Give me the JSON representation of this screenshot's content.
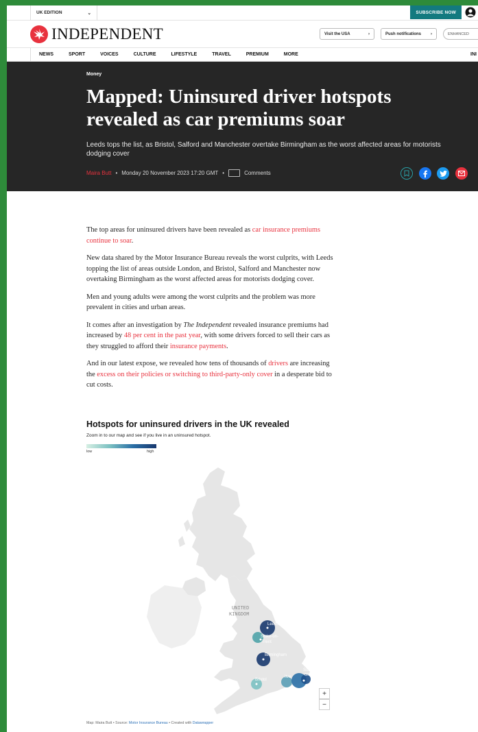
{
  "topbar": {
    "edition": "UK EDITION",
    "subscribe": "SUBSCRIBE NOW"
  },
  "brand": {
    "name": "INDEPENDENT"
  },
  "header_buttons": {
    "visit_usa": "Visit the USA",
    "push": "Push notifications",
    "enhanced": "ENHANCED"
  },
  "nav": {
    "items": [
      "NEWS",
      "SPORT",
      "VOICES",
      "CULTURE",
      "LIFESTYLE",
      "TRAVEL",
      "PREMIUM",
      "MORE"
    ],
    "right_edge": "INI"
  },
  "article": {
    "section": "Money",
    "headline": "Mapped: Uninsured driver hotspots revealed as car premiums soar",
    "standfirst": "Leeds tops the list, as Bristol, Salford and Manchester overtake Birmingham as the worst affected areas for motorists dodging cover",
    "author": "Maira Butt",
    "date": "Monday 20 November 2023 17:20 GMT",
    "separator": "•",
    "comments": "Comments",
    "p1_a": "The top areas for uninsured drivers have been revealed as ",
    "p1_link": "car insurance premiums continue to soar",
    "p1_b": ".",
    "p2": "New data shared by the Motor Insurance Bureau reveals the worst culprits, with Leeds topping the list of areas outside London, and Bristol, Salford and Manchester now overtaking Birmingham as the worst affected areas for motorists dodging cover.",
    "p3": "Men and young adults were among the worst culprits and the problem was more prevalent in cities and urban areas.",
    "p4_a": "It comes after an investigation by ",
    "p4_em": "The Independent",
    "p4_b": " revealed insurance premiums had increased by ",
    "p4_link1": "48 per cent in the past year",
    "p4_c": ", with some drivers forced to sell their cars as they struggled to afford their ",
    "p4_link2": "insurance payments",
    "p4_d": ".",
    "p5_a": "And in our latest expose, we revealed how tens of thousands of ",
    "p5_link1": "drivers",
    "p5_b": " are increasing the ",
    "p5_link2": "excess on their policies or switching to third-party-only cover",
    "p5_c": " in a desperate bid to cut costs."
  },
  "map": {
    "title": "Hotspots for uninsured drivers in the UK revealed",
    "subtitle": "Zoom in to our map and see if you live in an uninsured hotspot.",
    "legend_low": "low",
    "legend_high": "high",
    "country_label_1": "UNITED",
    "country_label_2": "KINGDOM",
    "labels": {
      "leeds": "Leeds",
      "stoke_1": "Stoke-on-",
      "stoke_2": "Trent",
      "birmingham": "Birmingham",
      "bristol": "Bristol",
      "southend_1": "Southend-",
      "southend_2": "on-Sea",
      "partial": "Ilve"
    },
    "zoom_in": "+",
    "zoom_out": "−",
    "credit_a": "Map: Maira Butt • Source: ",
    "credit_src": "Motor Insurance Bureau",
    "credit_b": " • Created with ",
    "credit_tool": "Datawrapper",
    "colors": {
      "low": "#d6efe3",
      "mid": "#7cc1c2",
      "high": "#18386e"
    }
  }
}
